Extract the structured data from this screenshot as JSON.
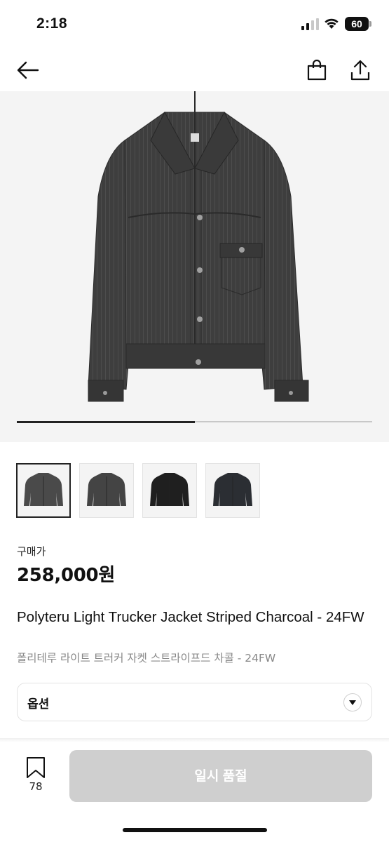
{
  "status_bar": {
    "time": "2:18",
    "battery_level": "60",
    "icons": [
      "signal-icon",
      "wifi-icon",
      "battery-icon"
    ]
  },
  "header": {
    "icons": [
      "back-arrow-icon",
      "shopping-bag-icon",
      "share-icon"
    ]
  },
  "gallery": {
    "image_count": 4,
    "selected_index": 0,
    "progress_fraction": 0.5,
    "background": "#f4f4f4"
  },
  "thumbnails": [
    {
      "color": "#4a4a4a"
    },
    {
      "color": "#444444"
    },
    {
      "color": "#1f1f1f"
    },
    {
      "color": "#2b2e33"
    }
  ],
  "price": {
    "label": "구매가",
    "value": "258,000원"
  },
  "product": {
    "name": "Polyteru Light Trucker Jacket Striped Charcoal - 24FW",
    "name_ko": "폴리테루 라이트 트러커 자켓 스트라이프드 차콜 - 24FW"
  },
  "option": {
    "label": "옵션"
  },
  "bottom_bar": {
    "wishlist_count": "78",
    "soldout_label": "일시 품절",
    "soldout_color": "#cfcfcf"
  }
}
